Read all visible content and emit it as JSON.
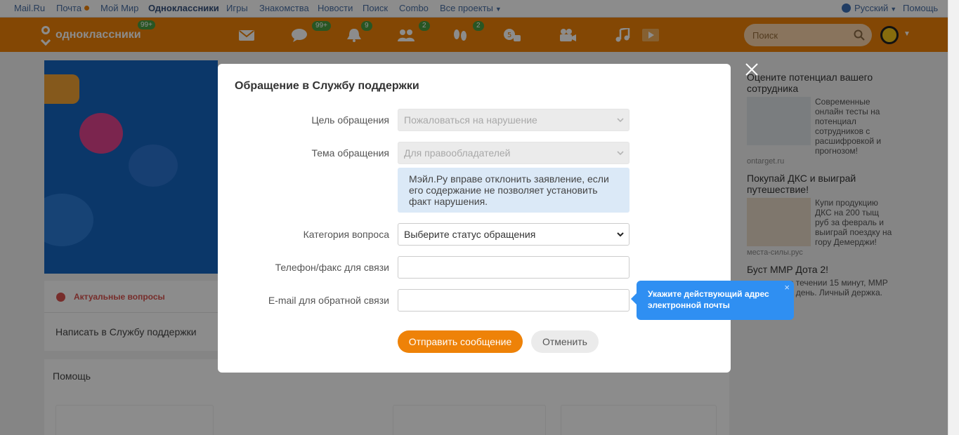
{
  "topnav": {
    "items": [
      "Mail.Ru",
      "Почта",
      "Мой Мир",
      "Одноклассники",
      "Игры",
      "Знакомства",
      "Новости",
      "Поиск",
      "Combo",
      "Все проекты"
    ],
    "language": "Русский",
    "help": "Помощь"
  },
  "header": {
    "logo_text": "одноклассники",
    "logo_badge": "99+",
    "badges": {
      "messages": "99+",
      "notifications": "9",
      "friends": "2",
      "guests": "2"
    },
    "search_placeholder": "Поиск",
    "brand_color": "#ee8208"
  },
  "background": {
    "actual_questions": "Актуальные вопросы",
    "write_support": "Написать в Службу поддержки",
    "help_title": "Помощь"
  },
  "ads": [
    {
      "title": "Оцените потенциал вашего сотрудника",
      "text": "Современные онлайн тесты на потенциал сотрудников с расшифровкой и прогнозом!",
      "source": "ontarget.ru"
    },
    {
      "title": "Покупай ДКС и выиграй путешествие!",
      "text": "Купи продукцию ДКС на 200 тыщ руб за февраль и выиграй поездку на гору Демерджи!",
      "source": "места-силы.рус"
    },
    {
      "title": "Буст MMP Дота 2!",
      "text": "в течении 15 минут, MMP в день. Личный держка.",
      "source": ""
    }
  ],
  "modal": {
    "title": "Обращение в Службу поддержки",
    "fields": {
      "purpose": {
        "label": "Цель обращения",
        "value": "Пожаловаться на нарушение"
      },
      "topic": {
        "label": "Тема обращения",
        "value": "Для правообладателей"
      },
      "notice": "Мэйл.Ру вправе отклонить заявление, если его содержание не позволяет установить факт нарушения.",
      "category": {
        "label": "Категория вопроса",
        "value": "Выберите статус обращения"
      },
      "phone": {
        "label": "Телефон/факс для связи",
        "value": ""
      },
      "email": {
        "label": "E-mail для обратной связи",
        "value": ""
      }
    },
    "submit_label": "Отправить сообщение",
    "cancel_label": "Отменить"
  },
  "tooltip": {
    "text": "Укажите действующий адрес электронной почты",
    "close": "×"
  }
}
